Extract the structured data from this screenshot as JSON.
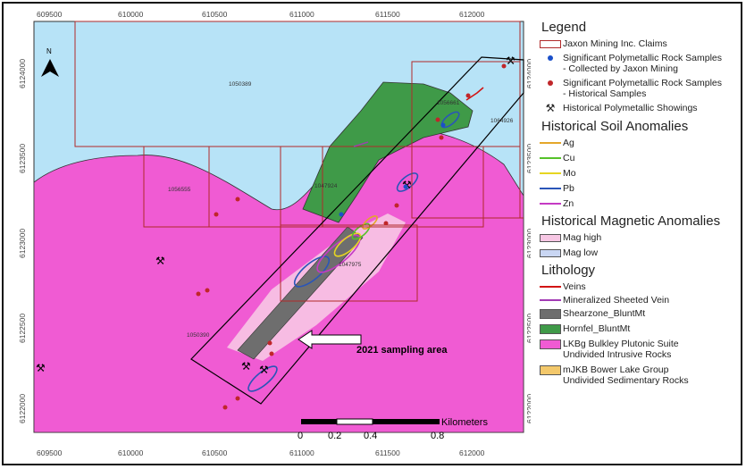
{
  "map": {
    "north_label": "N",
    "x_ticks": [
      "609500",
      "610000",
      "610500",
      "611000",
      "611500",
      "612000"
    ],
    "y_ticks": [
      "6124000",
      "6123500",
      "6123000",
      "6122500",
      "6122000"
    ],
    "claim_labels": [
      "1050389",
      "1064926",
      "1056555",
      "1047924",
      "1047975",
      "1050390",
      "1056661"
    ],
    "sampling_label": "2021 sampling area",
    "scale": {
      "unit": "Kilometers",
      "labels": [
        "0",
        "0.2",
        "0.4",
        "0.8"
      ]
    }
  },
  "legend": {
    "title": "Legend",
    "items_main": [
      {
        "label": "Jaxon Mining Inc. Claims",
        "icon": "claim-box"
      },
      {
        "label": "Significant Polymetallic Rock Samples\n- Collected by Jaxon Mining",
        "icon": "blue-dot"
      },
      {
        "label": "Significant Polymetallic Rock Samples\n- Historical Samples",
        "icon": "red-dot"
      },
      {
        "label": "Historical Polymetallic Showings",
        "icon": "pick-hammer"
      }
    ],
    "soil_title": "Historical Soil Anomalies",
    "soil_items": [
      {
        "label": "Ag",
        "color": "#e4a72a"
      },
      {
        "label": "Cu",
        "color": "#55c22a"
      },
      {
        "label": "Mo",
        "color": "#e6d521"
      },
      {
        "label": "Pb",
        "color": "#2a55b8"
      },
      {
        "label": "Zn",
        "color": "#c53ac4"
      }
    ],
    "mag_title": "Historical Magnetic Anomalies",
    "mag_items": [
      {
        "label": "Mag high",
        "color": "#f7c7e4"
      },
      {
        "label": "Mag low",
        "color": "#c9d6f3"
      }
    ],
    "litho_title": "Lithology",
    "litho_lines": [
      {
        "label": "Veins",
        "color": "#d21414"
      },
      {
        "label": "Mineralized Sheeted Vein",
        "color": "#a23bb5"
      }
    ],
    "litho_boxes": [
      {
        "label": "Shearzone_BluntMt",
        "color": "#6e6e6e"
      },
      {
        "label": "Hornfel_BluntMt",
        "color": "#3f9a48"
      },
      {
        "label": "LKBg Bulkley Plutonic Suite\nUndivided Intrusive Rocks",
        "color": "#f05bd3"
      },
      {
        "label": "mJKB Bower Lake Group\nUndivided Sedimentary Rocks",
        "color": "#f3c86b"
      }
    ]
  },
  "colors": {
    "sedimentary": "#b7e3f7",
    "intrusive": "#f05bd3",
    "hornfels": "#3f9a48",
    "claims": "#b02a2a"
  }
}
